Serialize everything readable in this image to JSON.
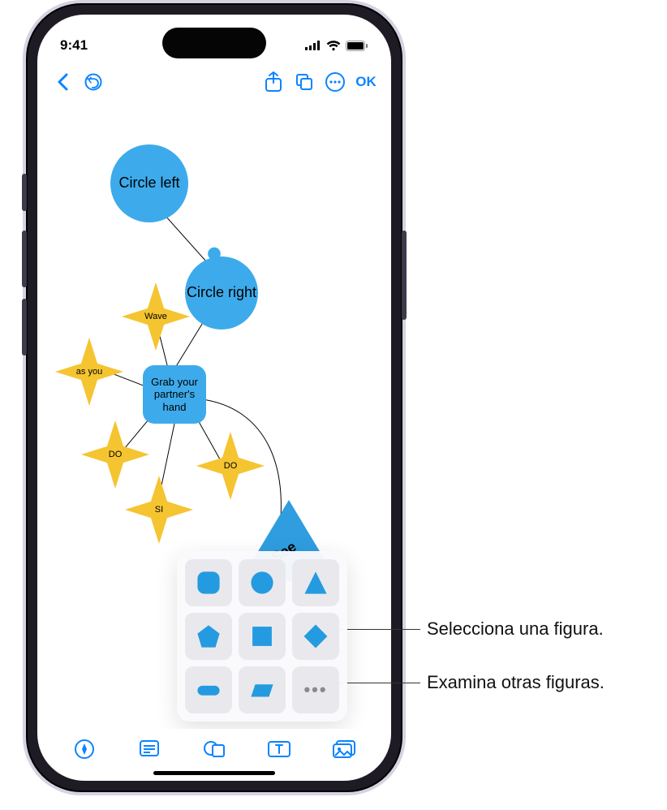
{
  "status": {
    "time": "9:41"
  },
  "toolbar": {
    "ok": "OK"
  },
  "diagram": {
    "circle_left": "Circle left",
    "circle_right": "Circle right",
    "grab": "Grab your partner's hand",
    "wave": "Wave",
    "as_you": "as you",
    "do1": "DO",
    "do2": "DO",
    "si": "SI",
    "see": "See"
  },
  "callouts": {
    "select": "Selecciona una figura.",
    "browse": "Examina otras figuras."
  }
}
